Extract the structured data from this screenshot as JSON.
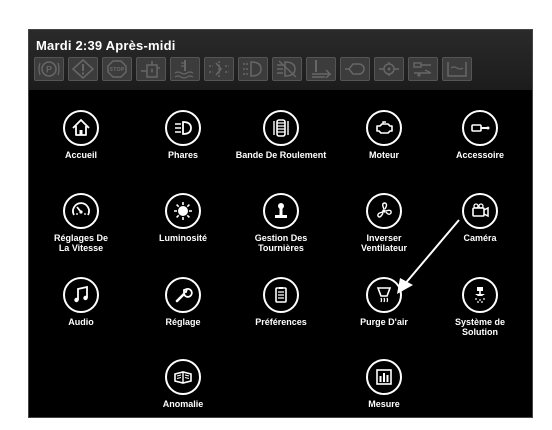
{
  "status": {
    "time": "Mardi 2:39 Après-midi"
  },
  "indicators": [
    {
      "icon": "parking-brake-icon"
    },
    {
      "icon": "warning-triangle-icon"
    },
    {
      "icon": "stop-icon",
      "text": "STOP"
    },
    {
      "icon": "fuel-filter-icon"
    },
    {
      "icon": "coolant-temp-icon"
    },
    {
      "icon": "headlight-indicator-icon"
    },
    {
      "icon": "high-beam-icon"
    },
    {
      "icon": "fog-light-off-icon"
    },
    {
      "icon": "transmission-temp-icon"
    },
    {
      "icon": "hydraulic-filter-icon"
    },
    {
      "icon": "oil-pressure-icon"
    },
    {
      "icon": "accessory-icon"
    },
    {
      "icon": "washer-fluid-icon"
    }
  ],
  "menu": {
    "accueil": "Accueil",
    "phares": "Phares",
    "bande": "Bande De Roulement",
    "moteur": "Moteur",
    "accessoire": "Accessoire",
    "vitesse": "Réglages De\nLa Vitesse",
    "luminosite": "Luminosité",
    "tournieres": "Gestion Des\nTournières",
    "ventilateur": "Inverser\nVentilateur",
    "camera": "Caméra",
    "audio": "Audio",
    "reglage": "Réglage",
    "preferences": "Préférences",
    "purge": "Purge D'air",
    "solution": "Système de\nSolution",
    "anomalie": "Anomalie",
    "mesure": "Mesure"
  }
}
